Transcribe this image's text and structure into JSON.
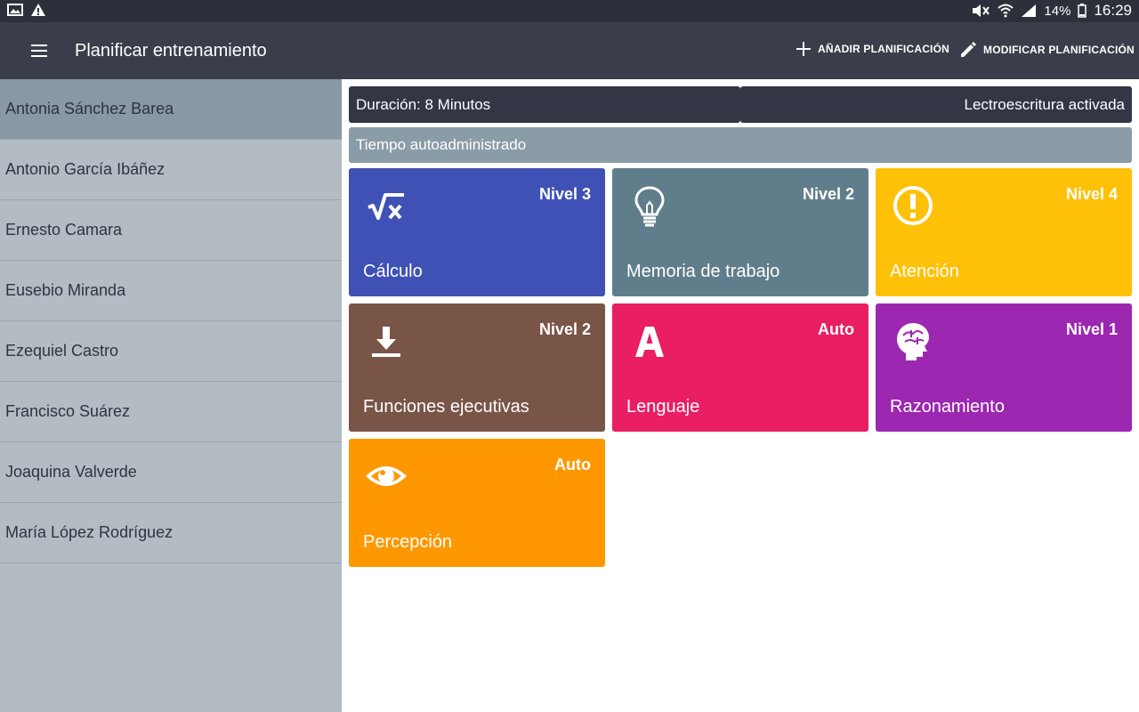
{
  "status_bar": {
    "battery": "14%",
    "time": "16:29"
  },
  "app_bar": {
    "title": "Planificar entrenamiento",
    "add_label": "AÑADIR PLANIFICACIÓN",
    "edit_label": "MODIFICAR PLANIFICACIÓN"
  },
  "patients": [
    "Antonia Sánchez Barea",
    "Antonio García Ibáñez",
    "Ernesto  Camara",
    "Eusebio Miranda",
    "Ezequiel Castro",
    "Francisco Suárez",
    "Joaquina Valverde",
    "María López Rodríguez"
  ],
  "info": {
    "duration": "Duración: 8 Minutos",
    "literacy": "Lectroescritura activada",
    "time_mode": "Tiempo autoadministrado"
  },
  "tiles": [
    {
      "name": "Cálculo",
      "level": "Nivel 3",
      "color": "#3f51b5",
      "icon": "sqrt-x-icon"
    },
    {
      "name": "Memoria de trabajo",
      "level": "Nivel 2",
      "color": "#607d8b",
      "icon": "lightbulb-icon"
    },
    {
      "name": "Atención",
      "level": "Nivel 4",
      "color": "#ffc107",
      "icon": "exclamation-circle-icon"
    },
    {
      "name": "Funciones ejecutivas",
      "level": "Nivel 2",
      "color": "#795548",
      "icon": "download-icon"
    },
    {
      "name": "Lenguaje",
      "level": "Auto",
      "color": "#e91e63",
      "icon": "letter-a-icon"
    },
    {
      "name": "Razonamiento",
      "level": "Nivel 1",
      "color": "#9c27b0",
      "icon": "brain-head-icon"
    },
    {
      "name": "Percepción",
      "level": "Auto",
      "color": "#ff9800",
      "icon": "eye-icon"
    }
  ]
}
